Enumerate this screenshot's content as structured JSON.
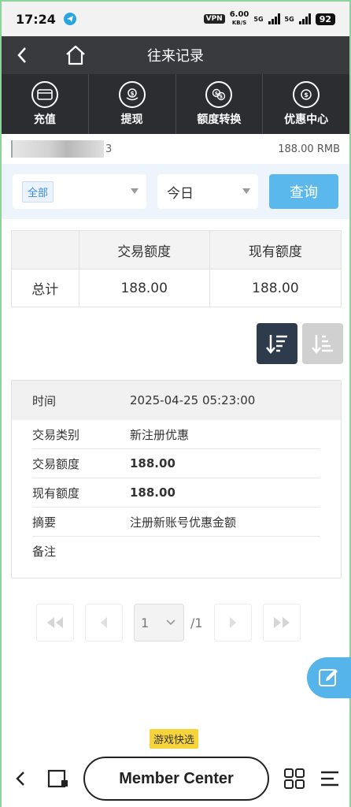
{
  "status_bar": {
    "time": "17:24",
    "vpn": "VPN",
    "speed_value": "6.00",
    "speed_unit": "KB/S",
    "net1": "5G",
    "net2": "5G",
    "battery": "92"
  },
  "header": {
    "title": "往来记录"
  },
  "quick_nav": [
    {
      "label": "充值",
      "icon": "recharge-icon"
    },
    {
      "label": "提现",
      "icon": "withdraw-icon"
    },
    {
      "label": "额度转换",
      "icon": "transfer-icon"
    },
    {
      "label": "优惠中心",
      "icon": "promo-icon"
    }
  ],
  "account": {
    "id_suffix": "3",
    "balance": "188.00 RMB"
  },
  "filters": {
    "type_value": "全部",
    "date_value": "今日",
    "query_label": "查询"
  },
  "summary": {
    "headers": [
      "",
      "交易额度",
      "现有额度"
    ],
    "total_label": "总计",
    "trade_amount": "188.00",
    "current_amount": "188.00"
  },
  "record": {
    "time_label": "时间",
    "time_value": "2025-04-25 05:23:00",
    "rows": [
      {
        "label": "交易类别",
        "value": "新注册优惠"
      },
      {
        "label": "交易额度",
        "value": "188.00"
      },
      {
        "label": "现有额度",
        "value": "188.00"
      },
      {
        "label": "摘要",
        "value": "注册新账号优惠金额"
      },
      {
        "label": "备注",
        "value": ""
      }
    ]
  },
  "pager": {
    "current_page": "1",
    "total_pages": "/1"
  },
  "game_quick_label": "游戏快选",
  "bottom_nav": {
    "member_center_label": "Member Center"
  },
  "colors": {
    "header_bg": "#393a3e",
    "nav_bg": "#2c2d31",
    "accent": "#5bb8ec",
    "sort_active": "#2d3b4c"
  }
}
